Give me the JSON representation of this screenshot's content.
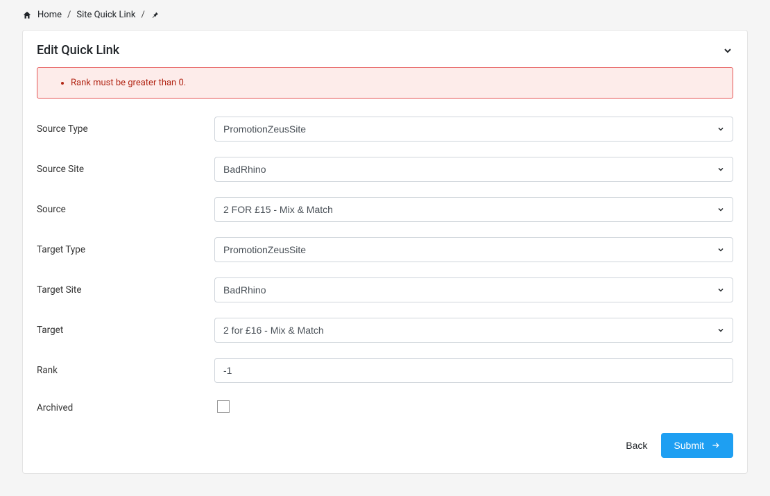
{
  "breadcrumb": {
    "home": "Home",
    "site_quick_link": "Site Quick Link"
  },
  "panel": {
    "title": "Edit Quick Link"
  },
  "errors": [
    "Rank must be greater than 0."
  ],
  "form": {
    "source_type": {
      "label": "Source Type",
      "value": "PromotionZeusSite"
    },
    "source_site": {
      "label": "Source Site",
      "value": "BadRhino"
    },
    "source": {
      "label": "Source",
      "value": "2 FOR £15 - Mix & Match"
    },
    "target_type": {
      "label": "Target Type",
      "value": "PromotionZeusSite"
    },
    "target_site": {
      "label": "Target Site",
      "value": "BadRhino"
    },
    "target": {
      "label": "Target",
      "value": "2 for £16 - Mix & Match"
    },
    "rank": {
      "label": "Rank",
      "value": "-1"
    },
    "archived": {
      "label": "Archived",
      "checked": false
    }
  },
  "actions": {
    "back": "Back",
    "submit": "Submit"
  }
}
